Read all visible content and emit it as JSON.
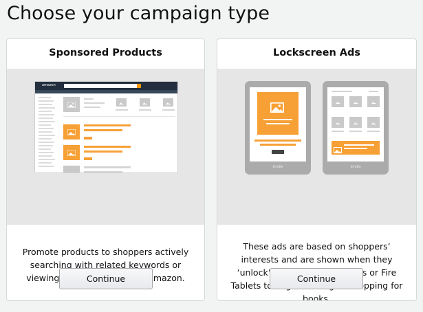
{
  "page": {
    "title": "Choose your campaign type"
  },
  "cards": [
    {
      "title": "Sponsored Products",
      "description": "Promote products to shoppers actively searching with related keywords or viewing similar products on Amazon.",
      "button_label": "Continue",
      "illustration": {
        "logo_text": "amazon"
      }
    },
    {
      "title": "Lockscreen Ads",
      "description": "These ads are based on shoppers’ interests and are shown when they ‘unlock’ their Kindle E-readers or Fire Tablets to begin reading or shopping for books.",
      "button_label": "Continue",
      "illustration": {
        "device_left_label": "kindle",
        "device_right_label": "kindle"
      }
    }
  ],
  "colors": {
    "accent_orange": "#f7a035",
    "placeholder_gray": "#c9c9c9",
    "header_dark": "#232f3e"
  },
  "icons": [
    "image-placeholder-icon"
  ]
}
